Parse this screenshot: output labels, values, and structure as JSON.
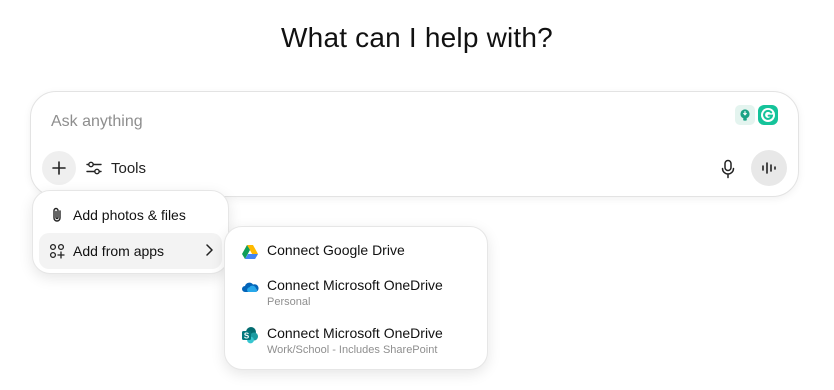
{
  "heading": "What can I help with?",
  "composer": {
    "placeholder": "Ask anything",
    "tools_label": "Tools"
  },
  "extensions": [
    {
      "icon": "lightbulb-icon"
    },
    {
      "icon": "grammarly-icon"
    }
  ],
  "attach_menu": {
    "items": [
      {
        "label": "Add photos & files",
        "icon": "paperclip-icon"
      },
      {
        "label": "Add from apps",
        "icon": "apps-grid-icon",
        "has_submenu": true
      }
    ]
  },
  "apps_submenu": {
    "items": [
      {
        "label": "Connect Google Drive",
        "sub": "",
        "icon": "google-drive-icon"
      },
      {
        "label": "Connect Microsoft OneDrive",
        "sub": "Personal",
        "icon": "onedrive-icon"
      },
      {
        "label": "Connect Microsoft OneDrive",
        "sub": "Work/School - Includes SharePoint",
        "icon": "sharepoint-icon"
      }
    ]
  },
  "colors": {
    "grammarly": "#15c39a",
    "onedrive": "#0364b8",
    "sharepoint": "#038387",
    "hover_bg": "#f3f3f3"
  }
}
